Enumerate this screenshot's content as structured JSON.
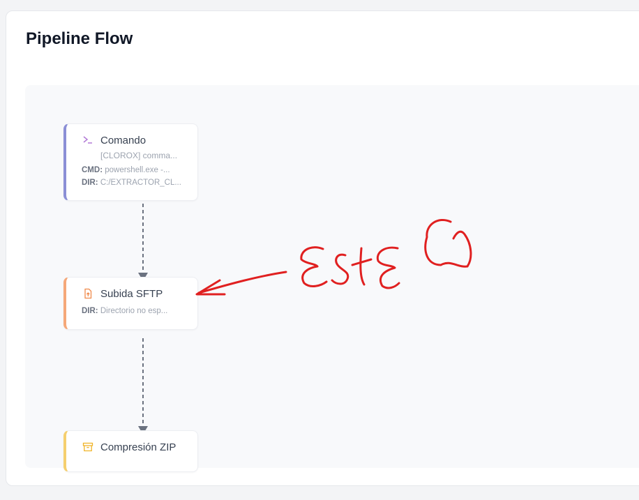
{
  "panel": {
    "title": "Pipeline Flow"
  },
  "nodes": [
    {
      "title": "Comando",
      "subtitle": "[CLOROX] comma...",
      "icon": "terminal-icon",
      "accent": "#8b8fd6",
      "cmd_label": "CMD:",
      "cmd_value": "powershell.exe -...",
      "dir_label": "DIR:",
      "dir_value": "C:/EXTRACTOR_CL..."
    },
    {
      "title": "Subida SFTP",
      "icon": "file-upload-icon",
      "accent": "#f5a879",
      "dir_label": "DIR:",
      "dir_value": "Directorio no esp..."
    },
    {
      "title": "Compresión ZIP",
      "icon": "archive-icon",
      "accent": "#f5cf6e"
    }
  ],
  "colors": {
    "edge": "#6b7280",
    "annotation": "#e02020"
  }
}
